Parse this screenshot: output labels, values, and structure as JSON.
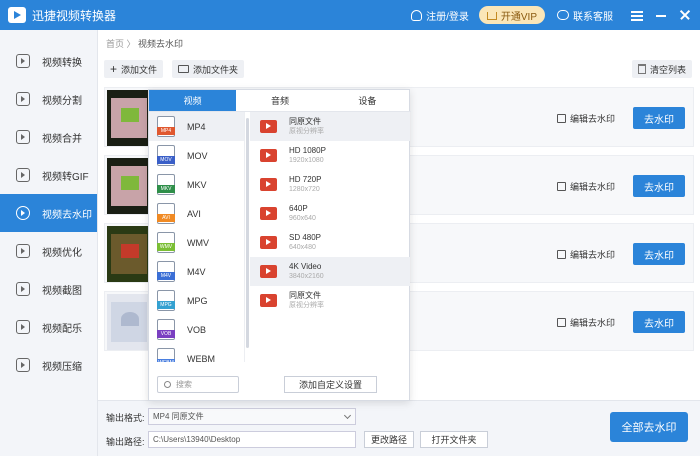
{
  "app": {
    "title": "迅捷视频转换器",
    "login": "注册/登录",
    "vip": "开通VIP",
    "support": "联系客服"
  },
  "sidebar": {
    "items": [
      {
        "label": "视频转换"
      },
      {
        "label": "视频分割"
      },
      {
        "label": "视频合并"
      },
      {
        "label": "视频转GIF"
      },
      {
        "label": "视频去水印"
      },
      {
        "label": "视频优化"
      },
      {
        "label": "视频截图"
      },
      {
        "label": "视频配乐"
      },
      {
        "label": "视频压缩"
      }
    ],
    "active_index": 4
  },
  "breadcrumb": {
    "home": "首页",
    "sep": " 〉",
    "current": "视频去水印"
  },
  "toolbar": {
    "add_file": "添加文件",
    "add_folder": "添加文件夹",
    "clear": "清空列表"
  },
  "rows": {
    "edit_label": "编辑去水印",
    "remove_label": "去水印"
  },
  "popup": {
    "tabs": [
      "视频",
      "音频",
      "设备"
    ],
    "formats": [
      {
        "name": "MP4",
        "color": "#e0582f"
      },
      {
        "name": "MOV",
        "color": "#3a5fc8"
      },
      {
        "name": "MKV",
        "color": "#2f8f4a"
      },
      {
        "name": "AVI",
        "color": "#f08a24"
      },
      {
        "name": "WMV",
        "color": "#7bbf35"
      },
      {
        "name": "M4V",
        "color": "#3b6fd6"
      },
      {
        "name": "MPG",
        "color": "#34a1d1"
      },
      {
        "name": "VOB",
        "color": "#7a3fc1"
      },
      {
        "name": "WEBM",
        "color": "#4a7fe0"
      }
    ],
    "resolutions": [
      {
        "name": "同原文件",
        "sub": "原视分辨率"
      },
      {
        "name": "HD 1080P",
        "sub": "1920x1080"
      },
      {
        "name": "HD 720P",
        "sub": "1280x720"
      },
      {
        "name": "640P",
        "sub": "960x640"
      },
      {
        "name": "SD 480P",
        "sub": "640x480"
      },
      {
        "name": "4K Video",
        "sub": "3840x2160"
      },
      {
        "name": "同原文件",
        "sub": "原视分辨率"
      }
    ],
    "search_placeholder": "搜索",
    "custom_button": "添加自定义设置"
  },
  "bottom": {
    "format_label": "输出格式:",
    "format_value": "MP4   同原文件",
    "path_label": "输出路径:",
    "path_value": "C:\\Users\\13940\\Desktop",
    "change_path": "更改路径",
    "open_folder": "打开文件夹",
    "all_remove": "全部去水印"
  },
  "colors": {
    "accent": "#2b84d9",
    "film_red": "#d9432f"
  }
}
